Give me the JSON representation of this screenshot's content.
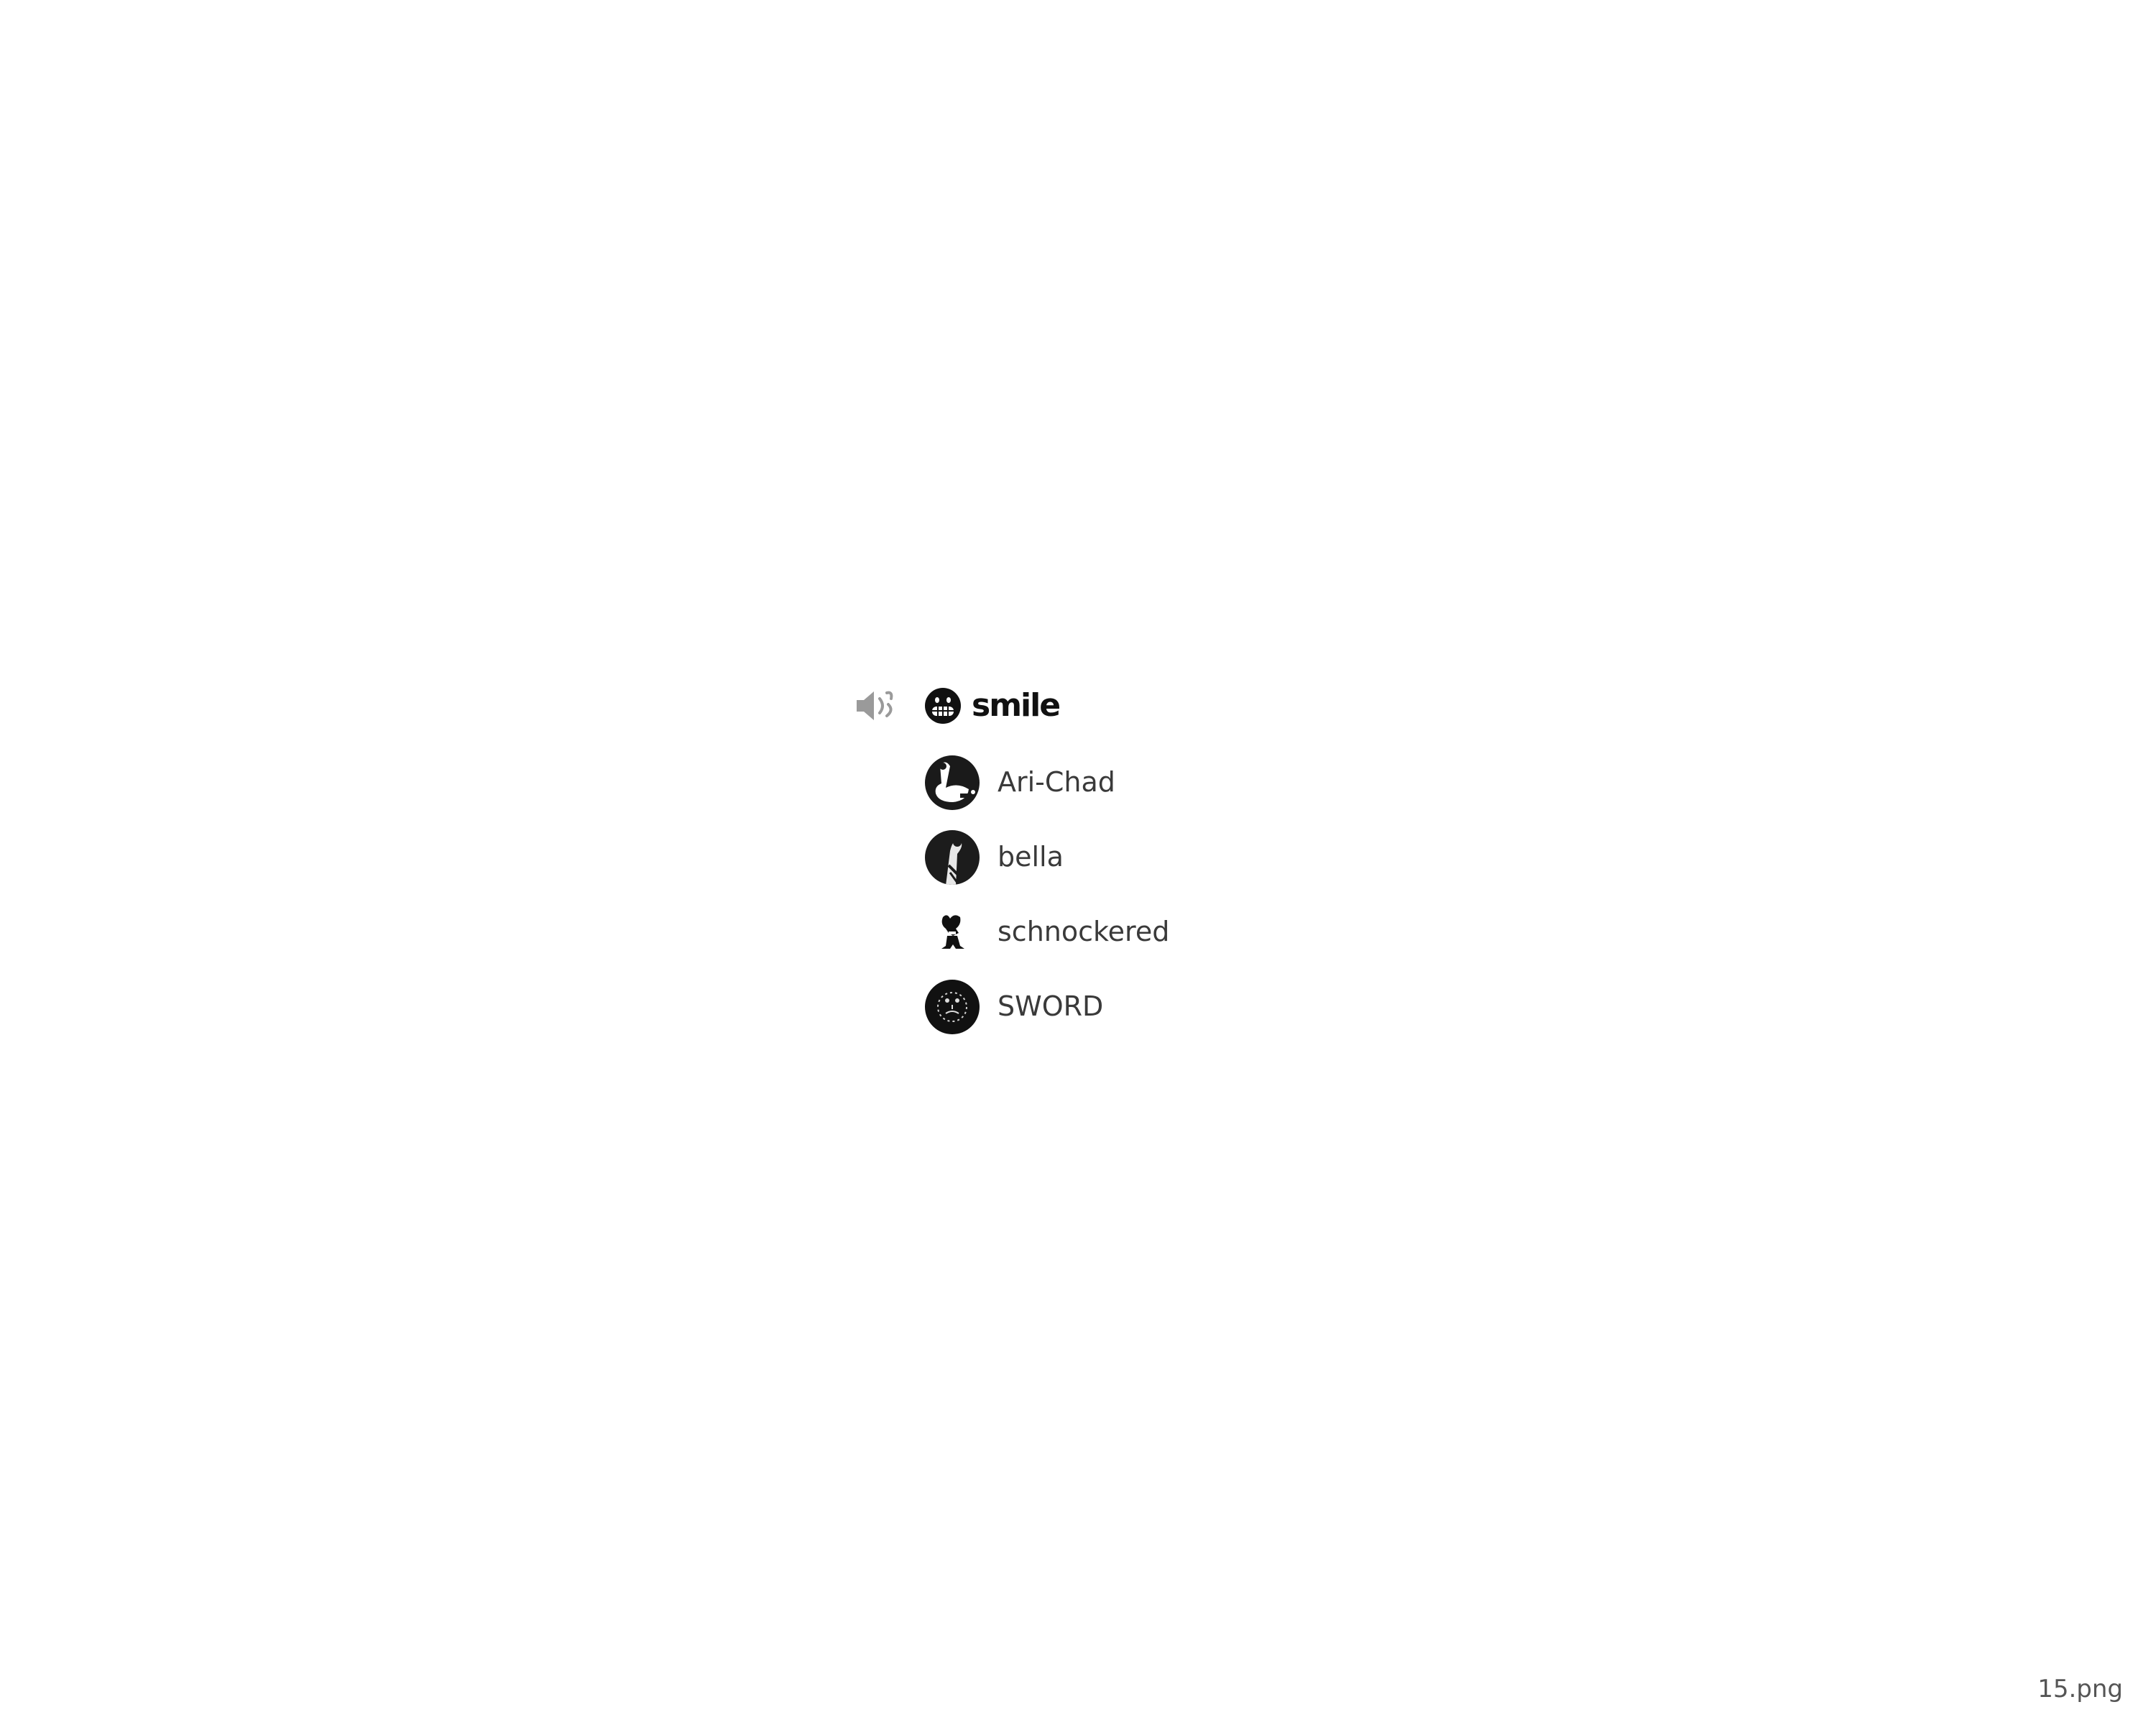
{
  "voice_channel": {
    "emoji_icon": "grinning-face-icon",
    "name": "smile",
    "members": [
      {
        "name": "Ari-Chad",
        "avatar": "avatar-ari-chad"
      },
      {
        "name": "bella",
        "avatar": "avatar-bella"
      },
      {
        "name": "schnockered",
        "avatar": "avatar-schnockered"
      },
      {
        "name": "SWORD",
        "avatar": "avatar-sword"
      }
    ]
  },
  "file_label": "15.png"
}
